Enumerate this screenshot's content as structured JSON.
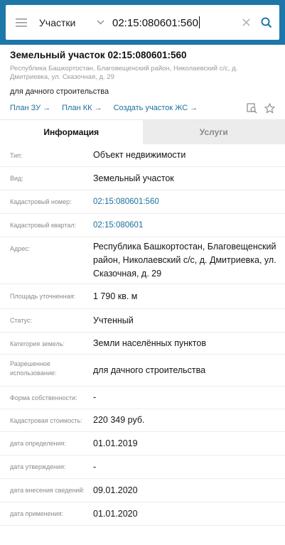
{
  "search": {
    "type_label": "Участки",
    "query": "02:15:080601:560"
  },
  "object": {
    "title": "Земельный участок 02:15:080601:560",
    "address_short": "Республика Башкортостан, Благовещенский район, Николаевский с/с, д. Дмитриевка, ул. Сказочная, д. 29",
    "purpose": "для дачного строительства",
    "links": [
      "План ЗУ →",
      "План КК →",
      "Создать участок ЖС →"
    ]
  },
  "tabs": [
    {
      "label": "Информация",
      "active": true
    },
    {
      "label": "Услуги",
      "active": false
    }
  ],
  "rows": [
    {
      "key": "Тип:",
      "value": "Объект недвижимости"
    },
    {
      "key": "Вид:",
      "value": "Земельный участок"
    },
    {
      "key": "Кадастровый номер:",
      "value": "02:15:080601:560",
      "link": true
    },
    {
      "key": "Кадастровый квартал:",
      "value": "02:15:080601",
      "link": true
    },
    {
      "key": "Адрес:",
      "value": "Республика Башкортостан, Благовещенский район, Николаевский с/с, д. Дмитриевка, ул. Сказочная, д. 29"
    },
    {
      "key": "Площадь уточненная:",
      "value": "1 790 кв. м"
    },
    {
      "key": "Статус:",
      "value": "Учтенный"
    },
    {
      "key": "Категория земель:",
      "value": "Земли населённых пунктов"
    },
    {
      "key": "Разрешенное использование:",
      "value": "для дачного строительства"
    },
    {
      "key": "Форма собственности:",
      "value": "-"
    },
    {
      "key": "Кадастровая стоимость:",
      "value": "220 349 руб."
    },
    {
      "key": "дата определения:",
      "value": "01.01.2019"
    },
    {
      "key": "дата утверждения:",
      "value": "-"
    },
    {
      "key": "дата внесения сведений:",
      "value": "09.01.2020"
    },
    {
      "key": "дата применения:",
      "value": "01.01.2020"
    }
  ],
  "colors": {
    "header_bg": "#1e77a9",
    "link": "#1c6f9c",
    "inactive_tab_bg": "#ececec"
  },
  "icons": [
    "menu-icon",
    "chevron-down-icon",
    "clear-icon",
    "search-icon",
    "map-search-icon",
    "star-icon"
  ]
}
